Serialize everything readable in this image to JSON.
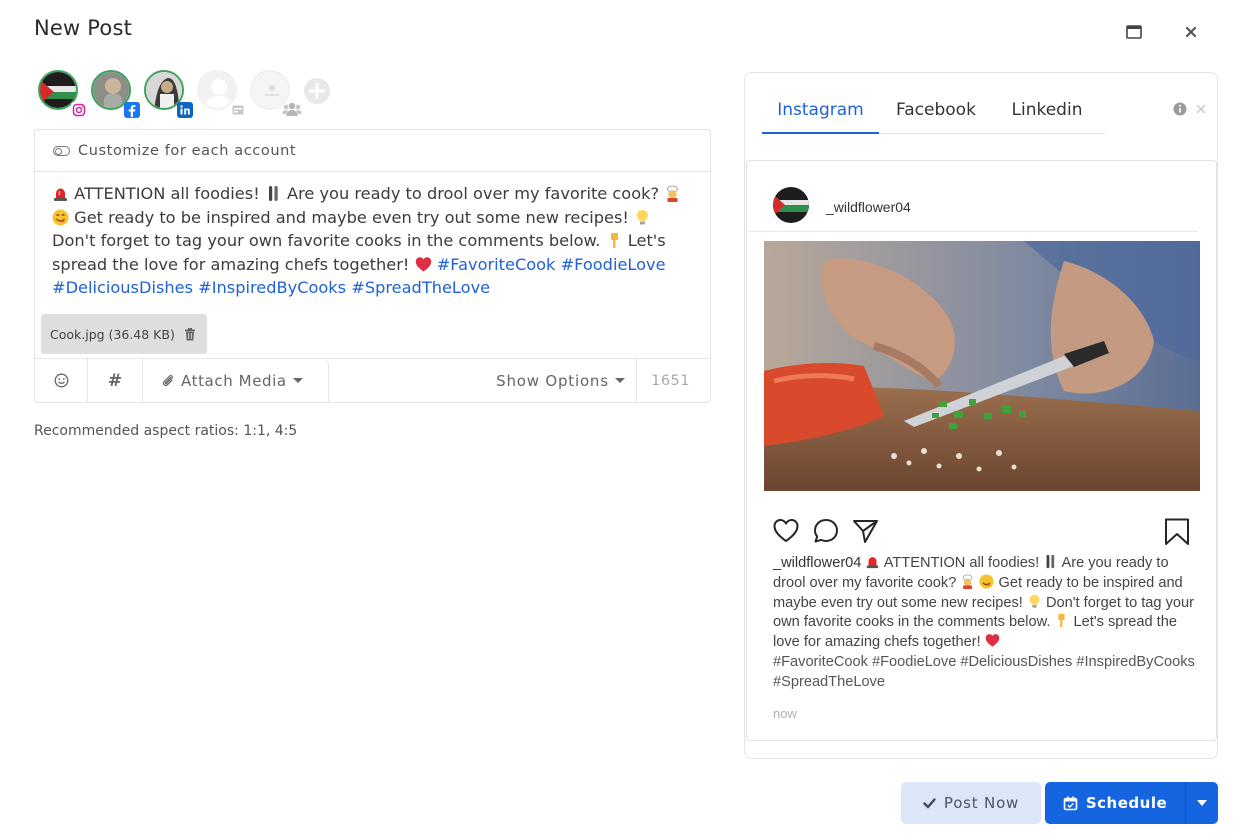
{
  "window": {
    "title": "New Post"
  },
  "accounts": [
    {
      "name": "account-instagram",
      "network": "instagram"
    },
    {
      "name": "account-facebook",
      "network": "facebook"
    },
    {
      "name": "account-linkedin",
      "network": "linkedin"
    },
    {
      "name": "account-generic",
      "network": "profile"
    },
    {
      "name": "account-group",
      "network": "group"
    }
  ],
  "composer": {
    "customize_label": "Customize for each account",
    "text_parts": {
      "p1": "ATTENTION all foodies!",
      "p2": "Are you ready to drool over my favorite cook?",
      "p3": "Get ready to be inspired and maybe even try out some new recipes!",
      "p4": "Don't forget to tag your own favorite cooks in the comments below.",
      "p5": "Let's spread the love for amazing chefs together!",
      "tags": "#FavoriteCook #FoodieLove #DeliciousDishes #InspiredByCooks #SpreadTheLove"
    },
    "attachment": "Cook.jpg (36.48 KB)",
    "toolbar": {
      "hash_label": "#",
      "attach_label": "Attach Media",
      "options_label": "Show Options",
      "char_count": "1651"
    },
    "aspect_note": "Recommended aspect ratios: 1:1, 4:5"
  },
  "preview": {
    "tabs": [
      "Instagram",
      "Facebook",
      "Linkedin"
    ],
    "active_tab": "Instagram",
    "username": "_wildflower04",
    "caption_parts": {
      "u": "_wildflower04",
      "p1": "ATTENTION all foodies!",
      "p2": "Are you ready to drool over my favorite cook?",
      "p3": "Get ready to be inspired and maybe even try out some new recipes!",
      "p4": "Don't forget to tag your own favorite cooks in the comments below.",
      "p5": "Let's spread the love for amazing chefs together!",
      "tags": "#FavoriteCook #FoodieLove #DeliciousDishes #InspiredByCooks #SpreadTheLove"
    },
    "time": "now"
  },
  "buttons": {
    "post_now": "Post Now",
    "schedule": "Schedule"
  },
  "colors": {
    "accent": "#1565e0",
    "hashtag": "#1f62d6",
    "post_now_bg": "#dbe7f8"
  }
}
